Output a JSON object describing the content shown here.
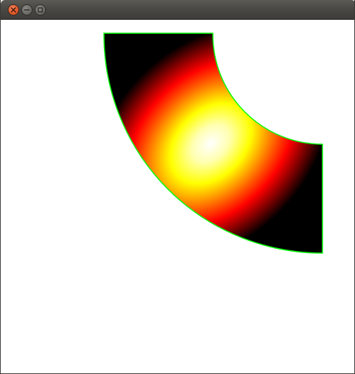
{
  "window": {
    "title": ""
  },
  "titlebar_buttons": [
    {
      "name": "close-button",
      "icon": "close-icon"
    },
    {
      "name": "minimize-button",
      "icon": "minimize-icon"
    },
    {
      "name": "maximize-button",
      "icon": "maximize-icon"
    }
  ],
  "shape": {
    "kind": "annular-sector",
    "fill": "radial gradient",
    "gradient_stops": [
      "#ffffff",
      "#ffff00",
      "#ff0000",
      "#000000"
    ],
    "stroke": "#00ff00"
  }
}
